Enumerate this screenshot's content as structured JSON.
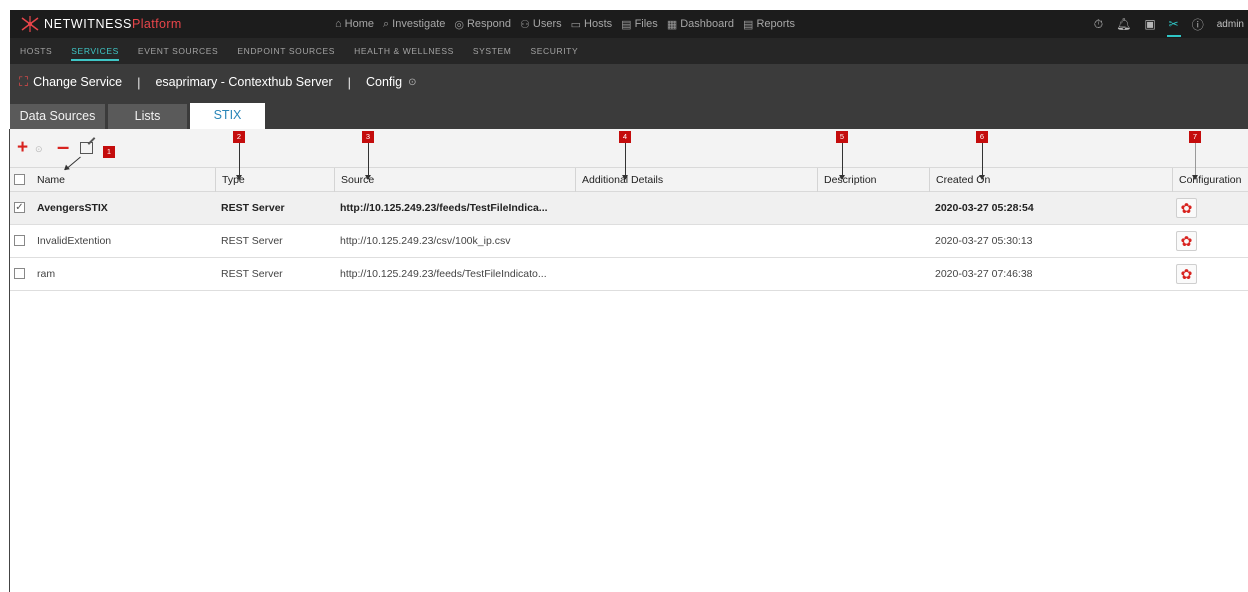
{
  "brand": {
    "part1": "NETWITNESS",
    "part2": "Platform",
    "accent": "#e8454a"
  },
  "main_nav": [
    {
      "icon": "⌂",
      "label": "Home",
      "icon_name": "home-icon"
    },
    {
      "icon": "⌕",
      "label": "Investigate",
      "icon_name": "investigate-icon"
    },
    {
      "icon": "◎",
      "label": "Respond",
      "icon_name": "respond-icon"
    },
    {
      "icon": "⚇",
      "label": "Users",
      "icon_name": "users-icon"
    },
    {
      "icon": "▭",
      "label": "Hosts",
      "icon_name": "hosts-icon"
    },
    {
      "icon": "▤",
      "label": "Files",
      "icon_name": "files-icon"
    },
    {
      "icon": "▦",
      "label": "Dashboard",
      "icon_name": "dashboard-icon"
    },
    {
      "icon": "▤",
      "label": "Reports",
      "icon_name": "reports-icon"
    }
  ],
  "user": {
    "name": "admin"
  },
  "sub_nav": [
    "HOSTS",
    "SERVICES",
    "EVENT SOURCES",
    "ENDPOINT SOURCES",
    "HEALTH & WELLNESS",
    "SYSTEM",
    "SECURITY"
  ],
  "sub_nav_active": "SERVICES",
  "service_bar": {
    "change_service": "Change Service",
    "separator": "|",
    "service_name": "esaprimary - Contexthub Server",
    "view": "Config"
  },
  "tabs": [
    "Data Sources",
    "Lists",
    "STIX"
  ],
  "active_tab": "STIX",
  "callouts": [
    "1",
    "2",
    "3",
    "4",
    "5",
    "6",
    "7"
  ],
  "columns": [
    "Name",
    "Type",
    "Source",
    "Additional Details",
    "Description",
    "Created On",
    "Configuration"
  ],
  "rows": [
    {
      "checked": true,
      "selected": true,
      "name": "AvengersSTIX",
      "type": "REST Server",
      "source": "http://10.125.249.23/feeds/TestFileIndica...",
      "details": "",
      "description": "",
      "created": "2020-03-27 05:28:54"
    },
    {
      "checked": false,
      "selected": false,
      "name": "InvalidExtention",
      "type": "REST Server",
      "source": "http://10.125.249.23/csv/100k_ip.csv",
      "details": "",
      "description": "",
      "created": "2020-03-27 05:30:13"
    },
    {
      "checked": false,
      "selected": false,
      "name": "ram",
      "type": "REST Server",
      "source": "http://10.125.249.23/feeds/TestFileIndicato...",
      "details": "",
      "description": "",
      "created": "2020-03-27 07:46:38"
    }
  ],
  "colors": {
    "accent_teal": "#2fc6c6",
    "action_red": "#d8231f",
    "callout_red": "#c40c0c",
    "tab_active_text": "#2a86b8"
  }
}
